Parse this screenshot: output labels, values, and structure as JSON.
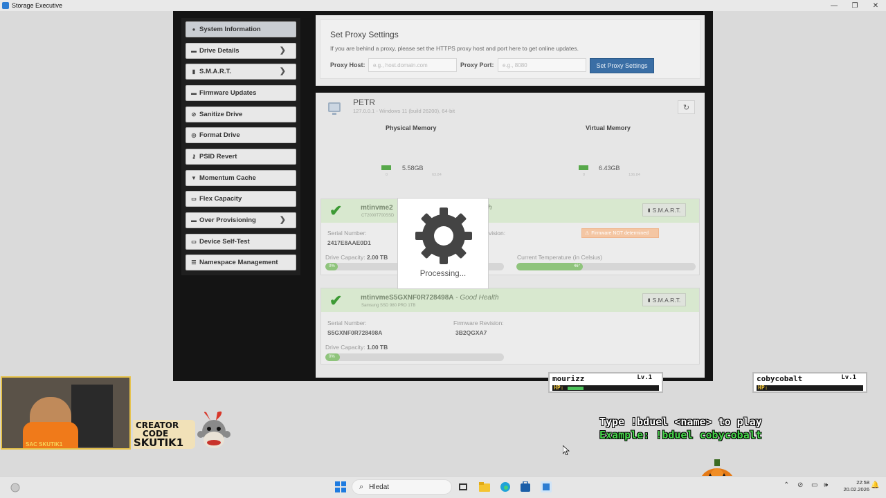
{
  "window": {
    "title": "Storage Executive",
    "controls": [
      "—",
      "❐",
      "✕"
    ]
  },
  "sidebar": {
    "items": [
      {
        "label": "System Information",
        "icon": "info-icon"
      },
      {
        "label": "Drive Details",
        "icon": "drive-icon"
      },
      {
        "label": "S.M.A.R.T.",
        "icon": "bar-chart-icon"
      },
      {
        "label": "Firmware Updates",
        "icon": "drive-icon"
      },
      {
        "label": "Sanitize Drive",
        "icon": "block-icon"
      },
      {
        "label": "Format Drive",
        "icon": "disc-icon"
      },
      {
        "label": "PSID Revert",
        "icon": "key-icon"
      },
      {
        "label": "Momentum Cache",
        "icon": "filter-icon"
      },
      {
        "label": "Flex Capacity",
        "icon": "square-icon"
      },
      {
        "label": "Over Provisioning",
        "icon": "drive-icon"
      },
      {
        "label": "Device Self-Test",
        "icon": "square-icon"
      },
      {
        "label": "Namespace Management",
        "icon": "list-icon"
      }
    ]
  },
  "proxy": {
    "title": "Set Proxy Settings",
    "description": "If you are behind a proxy, please set the HTTPS proxy host and port here to get online updates.",
    "host_label": "Proxy Host:",
    "host_placeholder": "e.g., host.domain.com",
    "port_label": "Proxy Port:",
    "port_placeholder": "e.g., 8080",
    "button": "Set Proxy Settings"
  },
  "system": {
    "name": "PETR",
    "subtitle": "127.0.0.1 - Windows 11 (build 26200), 64-bit",
    "physical_memory": {
      "label": "Physical Memory",
      "value": "5.58GB",
      "min": "0",
      "max": "63.84"
    },
    "virtual_memory": {
      "label": "Virtual Memory",
      "value": "6.43GB",
      "min": "0",
      "max": "136.84"
    }
  },
  "drives": [
    {
      "name": "mtinvme2",
      "model": "CT2000T700SSD",
      "health": "h",
      "smart_label": "S.M.A.R.T.",
      "serial_label": "Serial Number:",
      "serial": "2417E8AAE0D1",
      "firmware_label": "vision:",
      "firmware_status": "Firmware NOT determined",
      "capacity_label": "Drive Capacity:",
      "capacity": "2.00 TB",
      "capacity_used_label": "0%",
      "capacity_used_fraction": 0.04,
      "temp_label": "Current Temperature (in Celsius)",
      "temp_value": "46°",
      "temp_fraction": 0.37
    },
    {
      "name": "mtinvmeS5GXNF0R728498A",
      "model": "Samsung SSD 980 PRO 1TB",
      "health": " - Good Health",
      "smart_label": "S.M.A.R.T.",
      "serial_label": "Serial Number:",
      "serial": "S5GXNF0R728498A",
      "firmware_label": "Firmware Revision:",
      "firmware": "3B2QGXA7",
      "capacity_label": "Drive Capacity:",
      "capacity": "1.00 TB",
      "capacity_used_label": "0%",
      "capacity_used_fraction": 0.08
    }
  ],
  "modal": {
    "text": "Processing..."
  },
  "overlay": {
    "creator_line1": "CREATOR",
    "creator_line2": "CODE",
    "creator_line3": "SKUTIK1",
    "webcam_caption": "SAC SKUTIK1",
    "players": [
      {
        "name": "mourizz",
        "level": "Lv.1",
        "hp_label": "HP:",
        "hp_fraction": 0.18
      },
      {
        "name": "cobycobalt",
        "level": "Lv.1",
        "hp_label": "HP:",
        "hp_fraction": 0.0
      }
    ],
    "duel_line1": "Type !bduel <name> to play",
    "duel_line2": "Example: !bduel cobycobalt"
  },
  "taskbar": {
    "search_text": "Hledat",
    "time": "22:58",
    "date": "20.02.2026"
  }
}
